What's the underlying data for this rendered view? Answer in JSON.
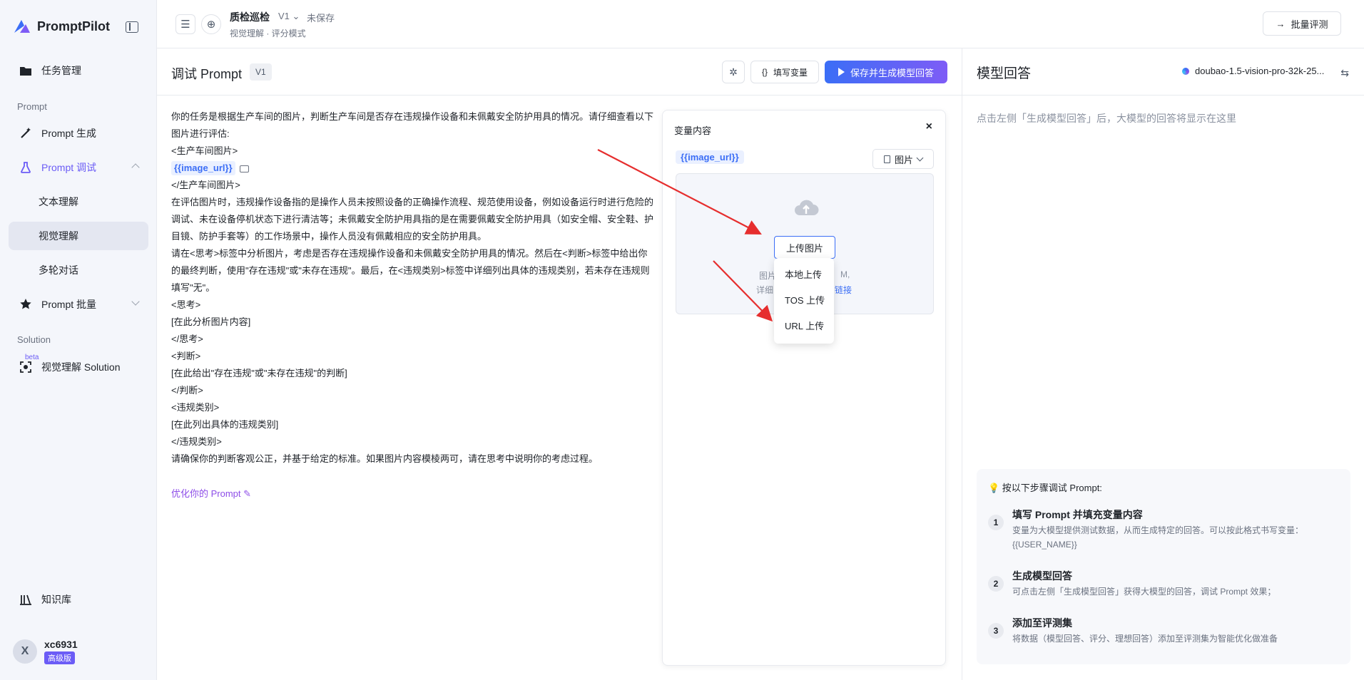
{
  "brand": {
    "name": "PromptPilot"
  },
  "sidebar": {
    "task_management": "任务管理",
    "section_prompt": "Prompt",
    "prompt_generate": "Prompt 生成",
    "prompt_debug": "Prompt 调试",
    "sub_items": [
      "文本理解",
      "视觉理解",
      "多轮对话"
    ],
    "prompt_batch": "Prompt 批量",
    "section_solution": "Solution",
    "beta_tag": "beta",
    "vision_solution": "视觉理解 Solution",
    "knowledge_base": "知识库",
    "user": {
      "initial": "X",
      "name": "xc6931",
      "tier": "高级版"
    }
  },
  "header": {
    "title": "质检巡检",
    "version": "V1",
    "status": "未保存",
    "subtitle": "视觉理解 · 评分模式",
    "batch_eval": "批量评测"
  },
  "debug": {
    "title": "调试 Prompt",
    "version_badge": "V1",
    "fill_vars": "填写变量",
    "save_generate": "保存并生成模型回答",
    "prompt_lines": [
      "你的任务是根据生产车间的图片，判断生产车间是否存在违规操作设备和未佩戴安全防护用具的情况。请仔细查看以下图片进行评估:",
      "<生产车间图片>",
      "{{image_url}}",
      "</生产车间图片>",
      "在评估图片时，违规操作设备指的是操作人员未按照设备的正确操作流程、规范使用设备，例如设备运行时进行危险的调试、未在设备停机状态下进行清洁等；未佩戴安全防护用具指的是在需要佩戴安全防护用具（如安全帽、安全鞋、护目镜、防护手套等）的工作场景中，操作人员没有佩戴相应的安全防护用具。",
      "请在<思考>标签中分析图片，考虑是否存在违规操作设备和未佩戴安全防护用具的情况。然后在<判断>标签中给出你的最终判断，使用\"存在违规\"或\"未存在违规\"。最后，在<违规类别>标签中详细列出具体的违规类别，若未存在违规则填写\"无\"。",
      "<思考>",
      "[在此分析图片内容]",
      "</思考>",
      "<判断>",
      "[在此给出\"存在违规\"或\"未存在违规\"的判断]",
      "</判断>",
      "<违规类别>",
      "[在此列出具体的违规类别]",
      "</违规类别>",
      "请确保你的判断客观公正，并基于给定的标准。如果图片内容模棱两可，请在思考中说明你的考虑过程。"
    ],
    "optimize_link": "优化你的 Prompt"
  },
  "variables": {
    "title": "变量内容",
    "var_name": "{{image_url}}",
    "type": "图片",
    "upload_button": "上传图片",
    "hint_left": "图片",
    "hint_right": "M,",
    "hint2_left": "详细",
    "hint2_link": "链接",
    "upload_options": [
      "本地上传",
      "TOS 上传",
      "URL 上传"
    ]
  },
  "response": {
    "title": "模型回答",
    "model": "doubao-1.5-vision-pro-32k-25...",
    "placeholder": "点击左侧「生成模型回答」后，大模型的回答将显示在这里",
    "steps_title": "💡 按以下步骤调试 Prompt:",
    "steps": [
      {
        "num": "1",
        "title": "填写 Prompt 并填充变量内容",
        "desc": "变量为大模型提供测试数据，从而生成特定的回答。可以按此格式书写变量：{{USER_NAME}}"
      },
      {
        "num": "2",
        "title": "生成模型回答",
        "desc": "可点击左侧「生成模型回答」获得大模型的回答，调试 Prompt 效果；"
      },
      {
        "num": "3",
        "title": "添加至评测集",
        "desc": "将数据（模型回答、评分、理想回答）添加至评测集为智能优化做准备"
      }
    ]
  },
  "colors": {
    "accent": "#3b6ef6",
    "purple": "#6b5cf6",
    "arrow": "#e62e2e"
  }
}
